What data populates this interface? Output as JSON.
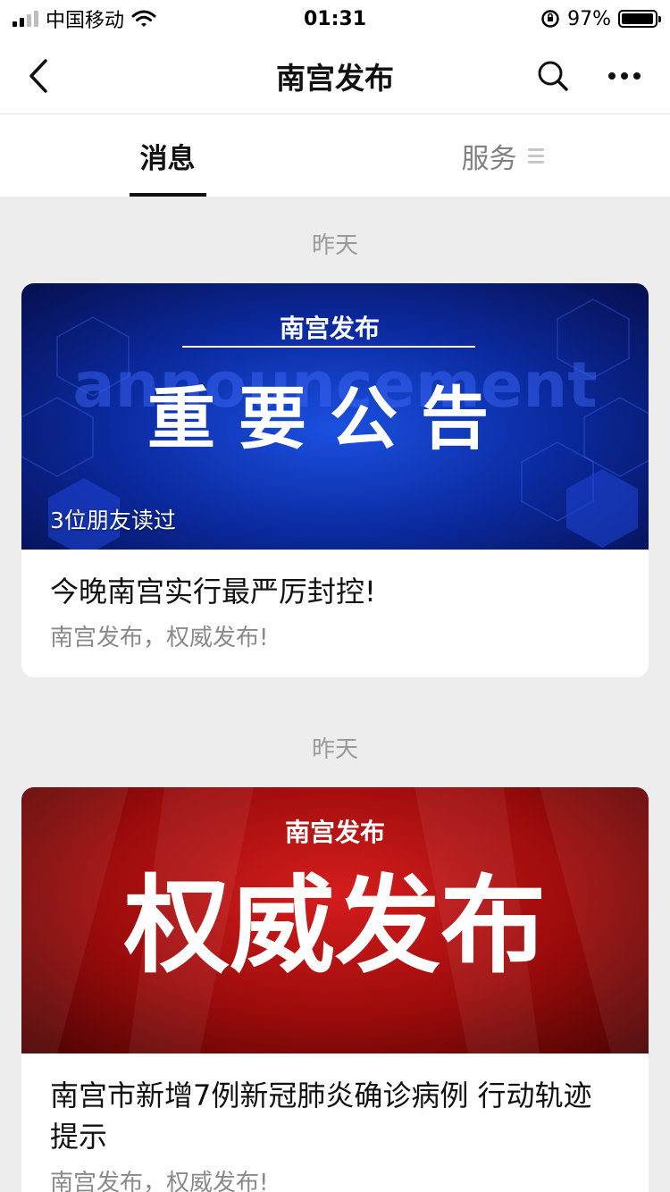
{
  "status_bar": {
    "carrier": "中国移动",
    "time": "01:31",
    "battery": "97%",
    "battery_level": 0.97
  },
  "nav": {
    "title": "南宫发布",
    "back_icon": "chevron-left-icon",
    "search_icon": "search-icon",
    "more_icon": "more-icon"
  },
  "tabs": {
    "messages": "消息",
    "services": "服务"
  },
  "feed": [
    {
      "date": "昨天",
      "cover": {
        "theme": "blue",
        "brand": "南宫发布",
        "headline": "重要公告",
        "watermark": "announcement"
      },
      "read_count": "3位朋友读过",
      "title": "今晚南宫实行最严厉封控!",
      "digest": "南宫发布，权威发布!"
    },
    {
      "date": "昨天",
      "cover": {
        "theme": "red",
        "brand": "南宫发布",
        "headline": "权威发布"
      },
      "title": "南宫市新增7例新冠肺炎确诊病例 行动轨迹提示",
      "digest": "南宫发布，权威发布!"
    }
  ]
}
